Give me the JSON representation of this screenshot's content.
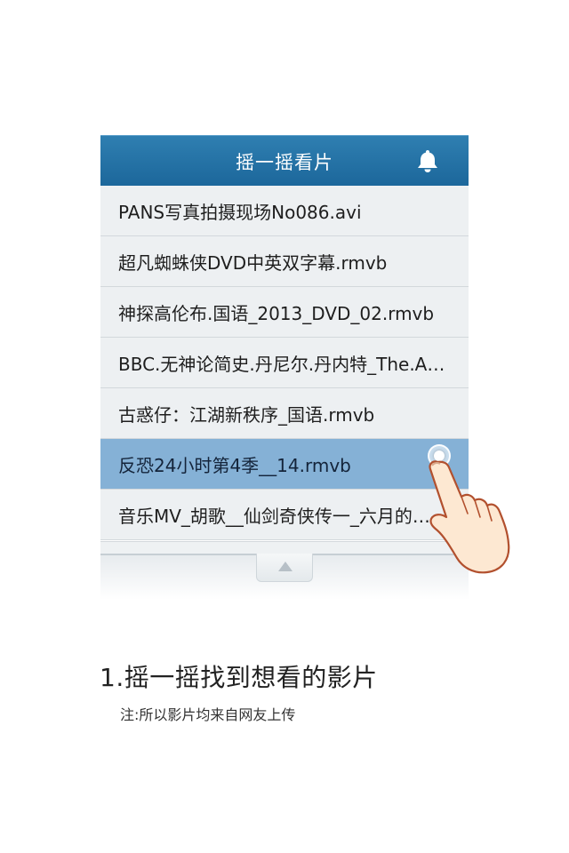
{
  "header": {
    "title": "摇一摇看片",
    "bell_icon": "bell-icon"
  },
  "files": [
    {
      "name": "PANS写真拍摄现场No086.avi",
      "selected": false
    },
    {
      "name": "超凡蜘蛛侠DVD中英双字幕.rmvb",
      "selected": false
    },
    {
      "name": "神探高伦布.国语_2013_DVD_02.rmvb",
      "selected": false
    },
    {
      "name": "BBC.无神论简史.丹尼尔.丹内特_The.A…",
      "selected": false
    },
    {
      "name": "古惑仔：江湖新秩序_国语.rmvb",
      "selected": false
    },
    {
      "name": "反恐24小时第4季__14.rmvb",
      "selected": true
    },
    {
      "name": "音乐MV_胡歌__仙剑奇侠传一_六月的…",
      "selected": false
    }
  ],
  "pull_tab_icon": "arrow-up-icon",
  "pointer_icon": "pointing-hand-icon",
  "caption": {
    "title": "1.摇一摇找到想看的影片",
    "note": "注:所以影片均来自网友上传"
  },
  "colors": {
    "navbar": "#1f6da1",
    "selected_row": "#85b1d6",
    "row": "#edf0f2"
  }
}
